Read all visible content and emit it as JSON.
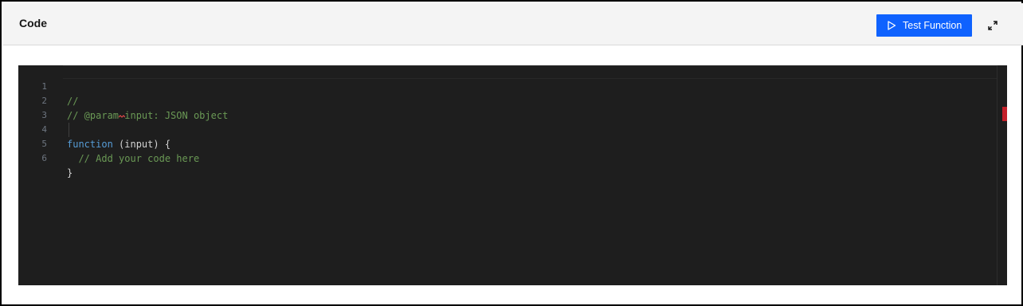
{
  "header": {
    "title": "Code",
    "test_button_label": "Test Function",
    "play_icon": "play-icon",
    "expand_icon": "expand-icon"
  },
  "editor": {
    "lines": [
      {
        "number": "1",
        "text": "//"
      },
      {
        "number": "2",
        "text": "// @param input: JSON object"
      },
      {
        "number": "3",
        "text": ""
      },
      {
        "number": "4",
        "keyword": "function",
        "rest": " (input) {"
      },
      {
        "number": "5",
        "text": "  // Add your code here"
      },
      {
        "number": "6",
        "text": "}"
      }
    ]
  },
  "colors": {
    "accent": "#0f62fe",
    "editor_bg": "#1e1e1e",
    "comment": "#6a9955",
    "keyword": "#569cd6",
    "error_marker": "#c4202a"
  }
}
